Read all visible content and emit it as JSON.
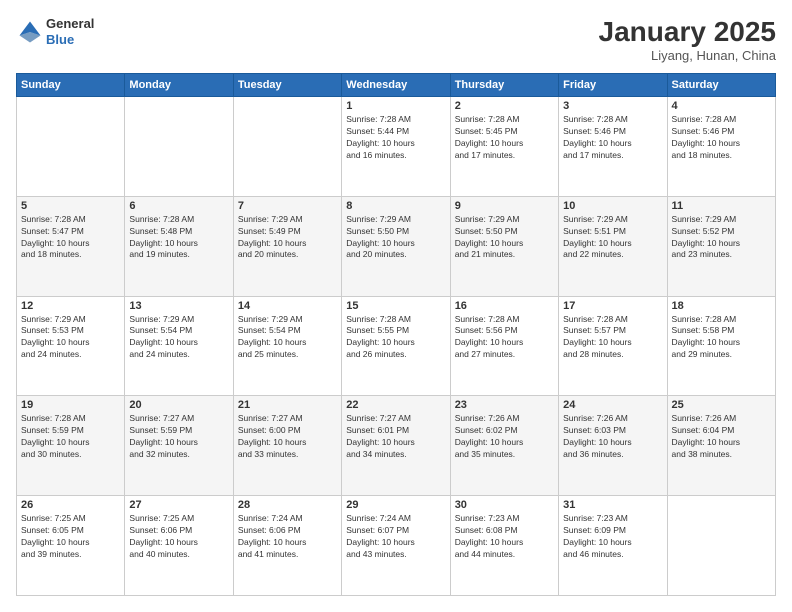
{
  "header": {
    "logo_general": "General",
    "logo_blue": "Blue",
    "month_title": "January 2025",
    "subtitle": "Liyang, Hunan, China"
  },
  "days_of_week": [
    "Sunday",
    "Monday",
    "Tuesday",
    "Wednesday",
    "Thursday",
    "Friday",
    "Saturday"
  ],
  "weeks": [
    [
      {
        "day": "",
        "info": ""
      },
      {
        "day": "",
        "info": ""
      },
      {
        "day": "",
        "info": ""
      },
      {
        "day": "1",
        "info": "Sunrise: 7:28 AM\nSunset: 5:44 PM\nDaylight: 10 hours\nand 16 minutes."
      },
      {
        "day": "2",
        "info": "Sunrise: 7:28 AM\nSunset: 5:45 PM\nDaylight: 10 hours\nand 17 minutes."
      },
      {
        "day": "3",
        "info": "Sunrise: 7:28 AM\nSunset: 5:46 PM\nDaylight: 10 hours\nand 17 minutes."
      },
      {
        "day": "4",
        "info": "Sunrise: 7:28 AM\nSunset: 5:46 PM\nDaylight: 10 hours\nand 18 minutes."
      }
    ],
    [
      {
        "day": "5",
        "info": "Sunrise: 7:28 AM\nSunset: 5:47 PM\nDaylight: 10 hours\nand 18 minutes."
      },
      {
        "day": "6",
        "info": "Sunrise: 7:28 AM\nSunset: 5:48 PM\nDaylight: 10 hours\nand 19 minutes."
      },
      {
        "day": "7",
        "info": "Sunrise: 7:29 AM\nSunset: 5:49 PM\nDaylight: 10 hours\nand 20 minutes."
      },
      {
        "day": "8",
        "info": "Sunrise: 7:29 AM\nSunset: 5:50 PM\nDaylight: 10 hours\nand 20 minutes."
      },
      {
        "day": "9",
        "info": "Sunrise: 7:29 AM\nSunset: 5:50 PM\nDaylight: 10 hours\nand 21 minutes."
      },
      {
        "day": "10",
        "info": "Sunrise: 7:29 AM\nSunset: 5:51 PM\nDaylight: 10 hours\nand 22 minutes."
      },
      {
        "day": "11",
        "info": "Sunrise: 7:29 AM\nSunset: 5:52 PM\nDaylight: 10 hours\nand 23 minutes."
      }
    ],
    [
      {
        "day": "12",
        "info": "Sunrise: 7:29 AM\nSunset: 5:53 PM\nDaylight: 10 hours\nand 24 minutes."
      },
      {
        "day": "13",
        "info": "Sunrise: 7:29 AM\nSunset: 5:54 PM\nDaylight: 10 hours\nand 24 minutes."
      },
      {
        "day": "14",
        "info": "Sunrise: 7:29 AM\nSunset: 5:54 PM\nDaylight: 10 hours\nand 25 minutes."
      },
      {
        "day": "15",
        "info": "Sunrise: 7:28 AM\nSunset: 5:55 PM\nDaylight: 10 hours\nand 26 minutes."
      },
      {
        "day": "16",
        "info": "Sunrise: 7:28 AM\nSunset: 5:56 PM\nDaylight: 10 hours\nand 27 minutes."
      },
      {
        "day": "17",
        "info": "Sunrise: 7:28 AM\nSunset: 5:57 PM\nDaylight: 10 hours\nand 28 minutes."
      },
      {
        "day": "18",
        "info": "Sunrise: 7:28 AM\nSunset: 5:58 PM\nDaylight: 10 hours\nand 29 minutes."
      }
    ],
    [
      {
        "day": "19",
        "info": "Sunrise: 7:28 AM\nSunset: 5:59 PM\nDaylight: 10 hours\nand 30 minutes."
      },
      {
        "day": "20",
        "info": "Sunrise: 7:27 AM\nSunset: 5:59 PM\nDaylight: 10 hours\nand 32 minutes."
      },
      {
        "day": "21",
        "info": "Sunrise: 7:27 AM\nSunset: 6:00 PM\nDaylight: 10 hours\nand 33 minutes."
      },
      {
        "day": "22",
        "info": "Sunrise: 7:27 AM\nSunset: 6:01 PM\nDaylight: 10 hours\nand 34 minutes."
      },
      {
        "day": "23",
        "info": "Sunrise: 7:26 AM\nSunset: 6:02 PM\nDaylight: 10 hours\nand 35 minutes."
      },
      {
        "day": "24",
        "info": "Sunrise: 7:26 AM\nSunset: 6:03 PM\nDaylight: 10 hours\nand 36 minutes."
      },
      {
        "day": "25",
        "info": "Sunrise: 7:26 AM\nSunset: 6:04 PM\nDaylight: 10 hours\nand 38 minutes."
      }
    ],
    [
      {
        "day": "26",
        "info": "Sunrise: 7:25 AM\nSunset: 6:05 PM\nDaylight: 10 hours\nand 39 minutes."
      },
      {
        "day": "27",
        "info": "Sunrise: 7:25 AM\nSunset: 6:06 PM\nDaylight: 10 hours\nand 40 minutes."
      },
      {
        "day": "28",
        "info": "Sunrise: 7:24 AM\nSunset: 6:06 PM\nDaylight: 10 hours\nand 41 minutes."
      },
      {
        "day": "29",
        "info": "Sunrise: 7:24 AM\nSunset: 6:07 PM\nDaylight: 10 hours\nand 43 minutes."
      },
      {
        "day": "30",
        "info": "Sunrise: 7:23 AM\nSunset: 6:08 PM\nDaylight: 10 hours\nand 44 minutes."
      },
      {
        "day": "31",
        "info": "Sunrise: 7:23 AM\nSunset: 6:09 PM\nDaylight: 10 hours\nand 46 minutes."
      },
      {
        "day": "",
        "info": ""
      }
    ]
  ]
}
